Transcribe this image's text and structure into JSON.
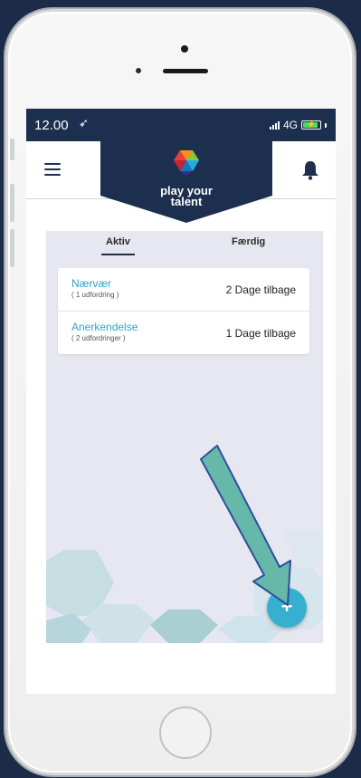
{
  "status_bar": {
    "time": "12.00",
    "location_icon": "location-arrow-icon",
    "network": "4G",
    "battery_icon": "battery-charging-icon"
  },
  "header": {
    "menu_icon": "hamburger-menu-icon",
    "logo_line1": "play your",
    "logo_line2": "talent",
    "notification_icon": "bell-icon"
  },
  "tabs": [
    {
      "label": "Aktiv",
      "active": true
    },
    {
      "label": "Færdig",
      "active": false
    }
  ],
  "challenges": [
    {
      "title": "Nærvær",
      "subtitle": "( 1 udfordring )",
      "time": "2 Dage tilbage"
    },
    {
      "title": "Anerkendelse",
      "subtitle": "( 2 udfordringer )",
      "time": "1 Dage tilbage"
    }
  ],
  "fab": {
    "label": "+",
    "icon": "plus-icon"
  },
  "colors": {
    "navy": "#1c2f4e",
    "accent": "#2fa5c8",
    "fab": "#35b1cf",
    "panel": "#e6e7f0",
    "arrow": "#66b8a8"
  }
}
